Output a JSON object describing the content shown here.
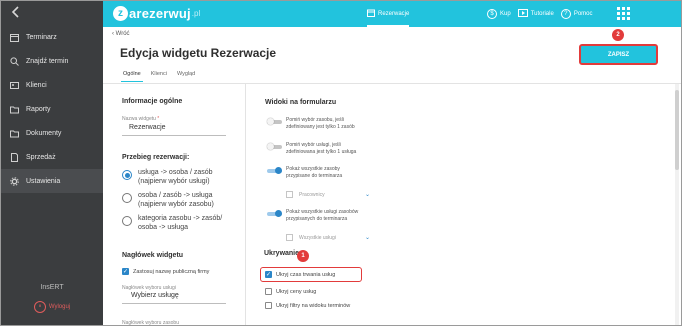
{
  "sidebar": {
    "back_icon": "chevron-left-icon",
    "items": [
      {
        "label": "Terminarz",
        "icon": "calendar-icon"
      },
      {
        "label": "Znajdź termin",
        "icon": "search-icon"
      },
      {
        "label": "Klienci",
        "icon": "id-card-icon"
      },
      {
        "label": "Raporty",
        "icon": "folder-icon"
      },
      {
        "label": "Dokumenty",
        "icon": "folder-icon"
      },
      {
        "label": "Sprzedaż",
        "icon": "document-icon"
      },
      {
        "label": "Ustawienia",
        "icon": "gear-icon"
      }
    ],
    "brand": "InsERT",
    "logout": "Wyloguj"
  },
  "topbar": {
    "logo_text": "arezerwuj",
    "logo_letter": "z",
    "logo_suffix": ".pl",
    "reservations": "Rezerwacje",
    "buy": "Kup",
    "tutorials": "Tutoriale",
    "help": "Pomoc",
    "color": "#22c3dd"
  },
  "header": {
    "back": "‹ Wróć",
    "title": "Edycja widgetu Rezerwacje",
    "save": "ZAPISZ",
    "tabs": [
      "Ogólne",
      "Klienci",
      "Wygląd"
    ],
    "active_tab": "Ogólne"
  },
  "general": {
    "title": "Informacje ogólne",
    "name_label": "Nazwa widgetu",
    "name_required": "*",
    "name_value": "Rezerwacje"
  },
  "flow": {
    "title": "Przebieg rezerwacji:",
    "options": [
      {
        "line1": "usługa -> osoba / zasób",
        "line2": "(najpierw wybór usługi)",
        "selected": true
      },
      {
        "line1": "osoba / zasób -> usługa",
        "line2": "(najpierw wybór zasobu)",
        "selected": false
      },
      {
        "line1": "kategoria zasobu -> zasób/",
        "line2": "osoba -> usługa",
        "selected": false
      }
    ]
  },
  "widget_header": {
    "title": "Nagłówek widgetu",
    "use_public_name": "Zastosuj nazwę publiczną firmy",
    "use_public_name_checked": true,
    "service_header_label": "Nagłówek wyboru usługi",
    "service_header_value": "Wybierz usługę",
    "resource_header_label": "Nagłówek wyboru zasobu"
  },
  "form_views": {
    "title": "Widoki na formularzu",
    "toggles": [
      {
        "line1": "Pomiń wybór zasobu, jeśli",
        "line2": "zdefiniowany jest tylko 1 zasób",
        "on": false
      },
      {
        "line1": "Pomiń wybór usługi, jeśli",
        "line2": "zdefiniowana jest tylko 1 usługa",
        "on": false
      },
      {
        "line1": "Pokaż wszystkie zasoby",
        "line2": "przypisane do terminarza",
        "on": true
      },
      {
        "line1": "Pokaż wszystkie usługi zasobów",
        "line2": "przypisanych do terminarza",
        "on": true
      }
    ],
    "employees_select": "Pracownicy",
    "services_select": "Wszystkie usługi"
  },
  "hiding": {
    "title": "Ukrywanie",
    "options": [
      {
        "label": "Ukryj czas trwania usług",
        "checked": true
      },
      {
        "label": "Ukryj ceny usług",
        "checked": false
      },
      {
        "label": "Ukryj filtry na widoku terminów",
        "checked": false
      }
    ]
  },
  "annotations": {
    "step1": "1",
    "step2": "2",
    "highlight_color": "#e23b3b"
  }
}
